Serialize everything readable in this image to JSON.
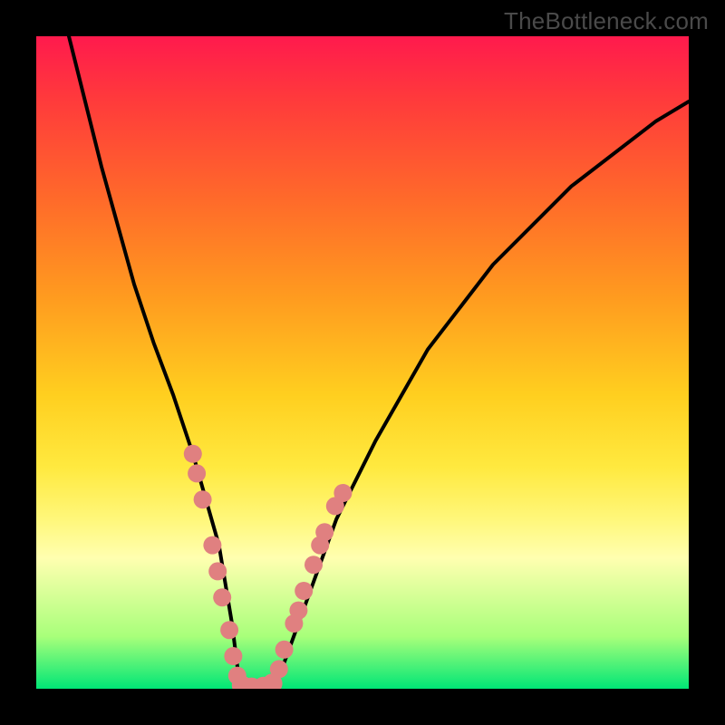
{
  "watermark": {
    "text": "TheBottleneck.com"
  },
  "chart_data": {
    "type": "line",
    "title": "",
    "xlabel": "",
    "ylabel": "",
    "xlim": [
      0,
      100
    ],
    "ylim": [
      0,
      100
    ],
    "series": [
      {
        "name": "curve",
        "x": [
          5,
          10,
          15,
          18,
          21,
          24,
          26,
          28,
          30,
          31,
          33,
          36,
          38,
          42,
          46,
          52,
          60,
          70,
          82,
          95,
          100
        ],
        "y": [
          100,
          80,
          62,
          53,
          45,
          36,
          29,
          22,
          10,
          2,
          0,
          0,
          4,
          15,
          26,
          38,
          52,
          65,
          77,
          87,
          90
        ]
      },
      {
        "name": "beads-left",
        "x": [
          24.0,
          24.6,
          25.5,
          27.0,
          27.8,
          28.5,
          29.6,
          30.2,
          30.8
        ],
        "y": [
          36,
          33,
          29,
          22,
          18,
          14,
          9,
          5,
          2
        ]
      },
      {
        "name": "beads-right",
        "x": [
          37.2,
          38.0,
          39.5,
          40.2,
          41.0,
          42.5,
          43.5,
          44.2,
          45.8,
          47.0
        ],
        "y": [
          3,
          6,
          10,
          12,
          15,
          19,
          22,
          24,
          28,
          30
        ]
      },
      {
        "name": "beads-bottom",
        "x": [
          31.5,
          33.0,
          34.8,
          36.2
        ],
        "y": [
          0.5,
          0.2,
          0.3,
          0.8
        ]
      }
    ],
    "colors": {
      "curve": "#000000",
      "beads": "#e08080"
    }
  }
}
